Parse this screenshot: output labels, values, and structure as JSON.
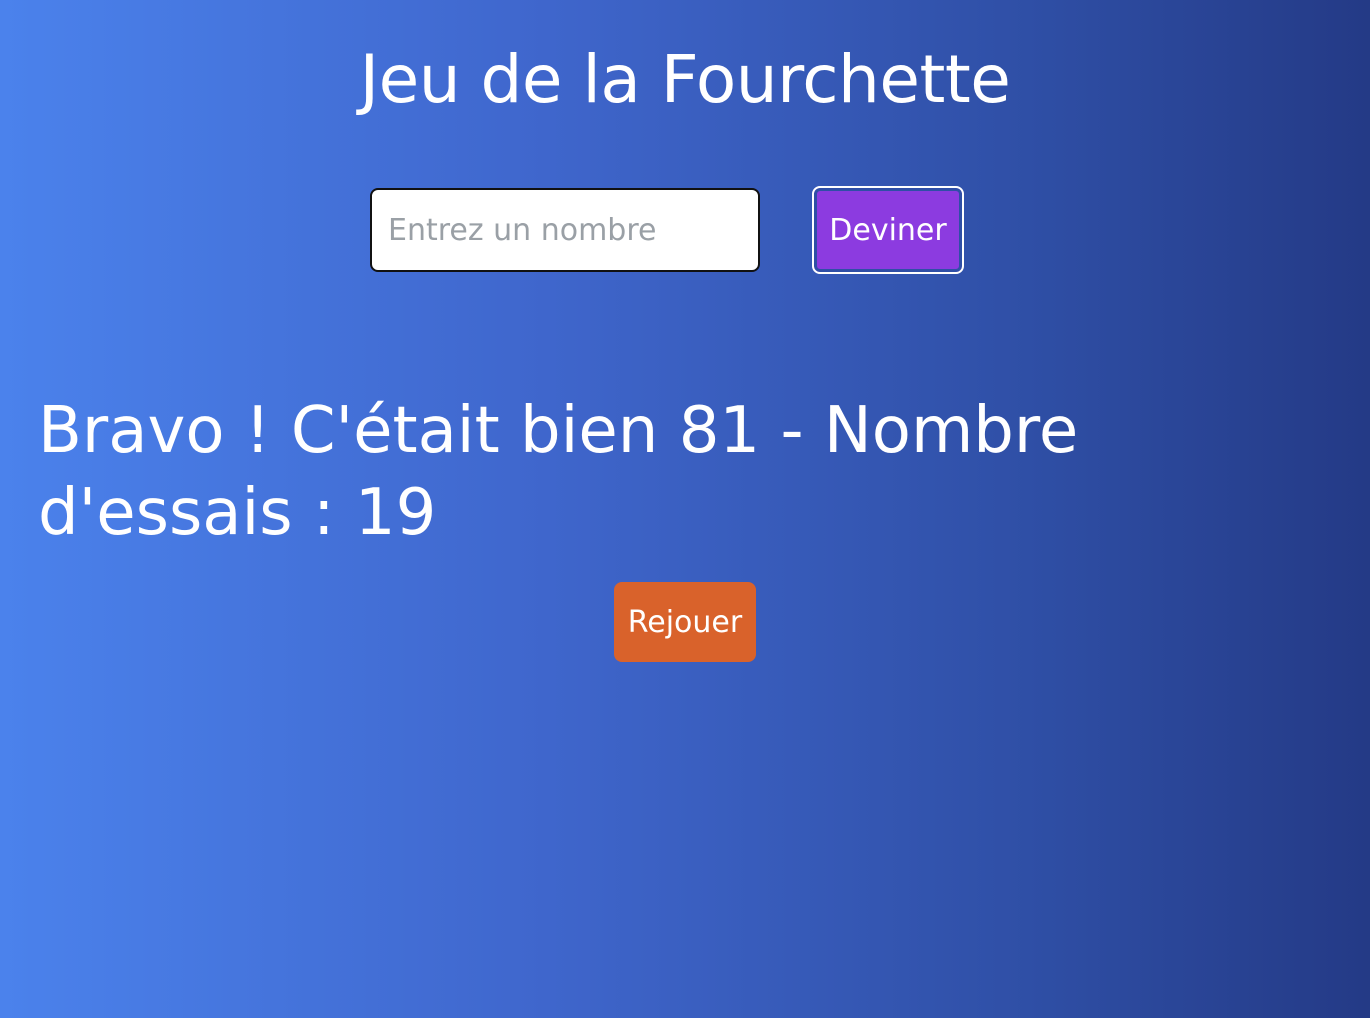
{
  "header": {
    "title": "Jeu de la Fourchette"
  },
  "guess_form": {
    "input_placeholder": "Entrez un nombre",
    "input_value": "",
    "submit_label": "Deviner"
  },
  "result": {
    "message": "Bravo ! C'était bien 81 - Nombre d'essais : 19"
  },
  "actions": {
    "replay_label": "Rejouer"
  },
  "colors": {
    "background_start": "#4b82ec",
    "background_end": "#243a86",
    "guess_button": "#8c3be0",
    "replay_button": "#d9622b"
  }
}
